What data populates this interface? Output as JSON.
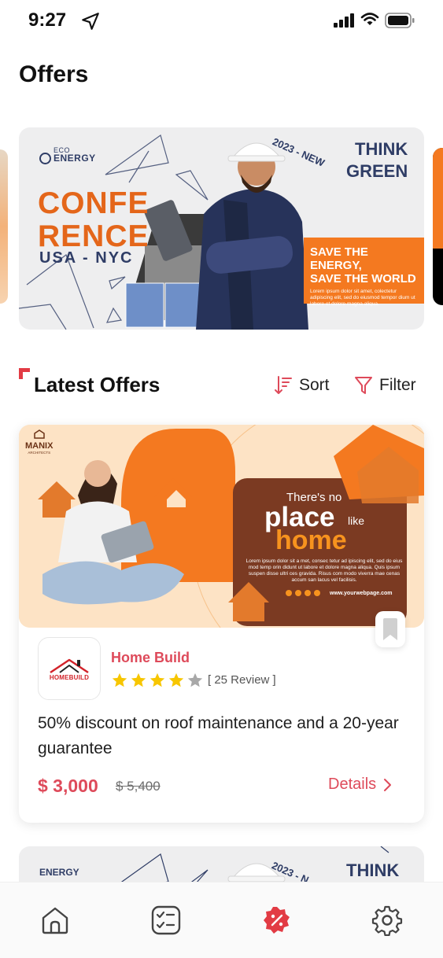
{
  "status_bar": {
    "time": "9:27"
  },
  "page": {
    "title": "Offers"
  },
  "hero": {
    "eco_small": "ECO",
    "eco_word": "ENERGY",
    "headline_line1": "CONFE",
    "headline_line2": "RENCE",
    "location": "USA - NYC",
    "year_text": "2023 - NEW",
    "slogan_line1": "THINK",
    "slogan_line2": "GREEN",
    "save_line1": "SAVE THE ENERGY,",
    "save_line2": "SAVE THE WORLD",
    "save_body": "Lorem ipsum dolor sit amet, colectetur adipiscing elit, sed do eiusmod tempor dium ut labore et dolore magna aliqua."
  },
  "section": {
    "title": "Latest Offers",
    "sort_label": "Sort",
    "filter_label": "Filter"
  },
  "offer": {
    "banner": {
      "logo_name": "MANIX",
      "logo_sub": "ARCHITECTS",
      "line1": "There's no",
      "line2_a": "place",
      "line2_b": "like",
      "line3": "home",
      "body": "Lorem ipsum dolor sit a met, consec tetur ad ipiscing elit, sed do eius mod temp orin didunt ut labore et dolore magna aliqua. Quis ipsum suspen disse ultri ces gravida. Risus com modo viverra mae cenas accum san lacus vel facilisis.",
      "website": "www.yourwebpage.com"
    },
    "brand_logo_text": "HOMEBUILD",
    "brand_name": "Home Build",
    "rating": 4,
    "rating_max": 5,
    "review_text": "[ 25 Review ]",
    "description": "50% discount on roof maintenance and a 20-year guarantee",
    "price_now": "$ 3,000",
    "price_old": "$ 5,400",
    "details_label": "Details"
  },
  "offer2": {
    "eco_word": "ENERGY",
    "slogan": "THINK",
    "year_text": "2023 - N"
  },
  "colors": {
    "accent": "#de4a5a",
    "orange": "#f47920",
    "navy": "#2f3d66",
    "star": "#f7c600"
  },
  "nav": {
    "items": [
      {
        "icon": "home-icon",
        "active": false
      },
      {
        "icon": "checklist-icon",
        "active": false
      },
      {
        "icon": "discount-badge-icon",
        "active": true
      },
      {
        "icon": "gear-icon",
        "active": false
      }
    ]
  }
}
